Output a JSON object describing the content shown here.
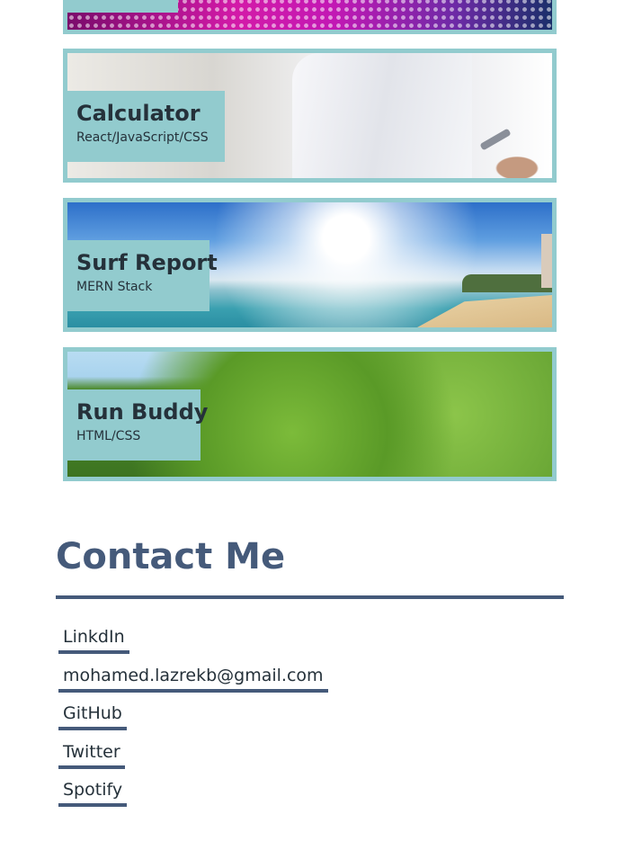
{
  "projects": [
    {
      "title": "",
      "subtitle": ""
    },
    {
      "title": "Calculator",
      "subtitle": "React/JavaScript/CSS"
    },
    {
      "title": "Surf Report",
      "subtitle": "MERN Stack"
    },
    {
      "title": "Run Buddy",
      "subtitle": "HTML/CSS"
    }
  ],
  "contact": {
    "heading": "Contact Me",
    "links": [
      {
        "label": "LinkdIn"
      },
      {
        "label": "mohamed.lazrekb@gmail.com"
      },
      {
        "label": "GitHub"
      },
      {
        "label": "Twitter"
      },
      {
        "label": "Spotify"
      }
    ]
  },
  "colors": {
    "accent": "#92cbce",
    "heading": "#455a7a",
    "text": "#25313a"
  }
}
